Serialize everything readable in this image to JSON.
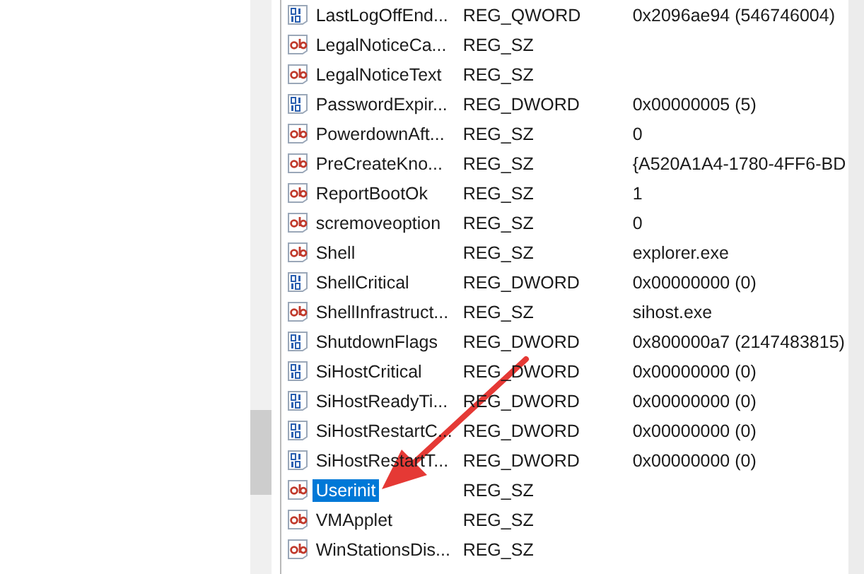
{
  "values": [
    {
      "name": "LastLogOffEnd...",
      "type": "REG_QWORD",
      "kind": "binary",
      "data": "0x2096ae94 (546746004)",
      "selected": false
    },
    {
      "name": "LegalNoticeCa...",
      "type": "REG_SZ",
      "kind": "string",
      "selected": false
    },
    {
      "name": "LegalNoticeText",
      "type": "REG_SZ",
      "kind": "string",
      "selected": false
    },
    {
      "name": "PasswordExpir...",
      "type": "REG_DWORD",
      "kind": "binary",
      "data": "0x00000005 (5)",
      "selected": false
    },
    {
      "name": "PowerdownAft...",
      "type": "REG_SZ",
      "kind": "string",
      "data": "0",
      "selected": false
    },
    {
      "name": "PreCreateKno...",
      "type": "REG_SZ",
      "kind": "string",
      "data": "{A520A1A4-1780-4FF6-BD",
      "selected": false
    },
    {
      "name": "ReportBootOk",
      "type": "REG_SZ",
      "kind": "string",
      "data": "1",
      "selected": false
    },
    {
      "name": "scremoveoption",
      "type": "REG_SZ",
      "kind": "string",
      "data": "0",
      "selected": false
    },
    {
      "name": "Shell",
      "type": "REG_SZ",
      "kind": "string",
      "data": "explorer.exe",
      "selected": false
    },
    {
      "name": "ShellCritical",
      "type": "REG_DWORD",
      "kind": "binary",
      "data": "0x00000000 (0)",
      "selected": false
    },
    {
      "name": "ShellInfrastruct...",
      "type": "REG_SZ",
      "kind": "string",
      "data": "sihost.exe",
      "selected": false
    },
    {
      "name": "ShutdownFlags",
      "type": "REG_DWORD",
      "kind": "binary",
      "data": "0x800000a7 (2147483815)",
      "selected": false
    },
    {
      "name": "SiHostCritical",
      "type": "REG_DWORD",
      "kind": "binary",
      "data": "0x00000000 (0)",
      "selected": false
    },
    {
      "name": "SiHostReadyTi...",
      "type": "REG_DWORD",
      "kind": "binary",
      "data": "0x00000000 (0)",
      "selected": false
    },
    {
      "name": "SiHostRestartC...",
      "type": "REG_DWORD",
      "kind": "binary",
      "data": "0x00000000 (0)",
      "selected": false
    },
    {
      "name": "SiHostRestartT...",
      "type": "REG_DWORD",
      "kind": "binary",
      "data": "0x00000000 (0)",
      "selected": false
    },
    {
      "name": "Userinit",
      "type": "REG_SZ",
      "kind": "string",
      "selected": true
    },
    {
      "name": "VMApplet",
      "type": "REG_SZ",
      "kind": "string",
      "selected": false
    },
    {
      "name": "WinStationsDis...",
      "type": "REG_SZ",
      "kind": "string",
      "selected": false
    }
  ]
}
